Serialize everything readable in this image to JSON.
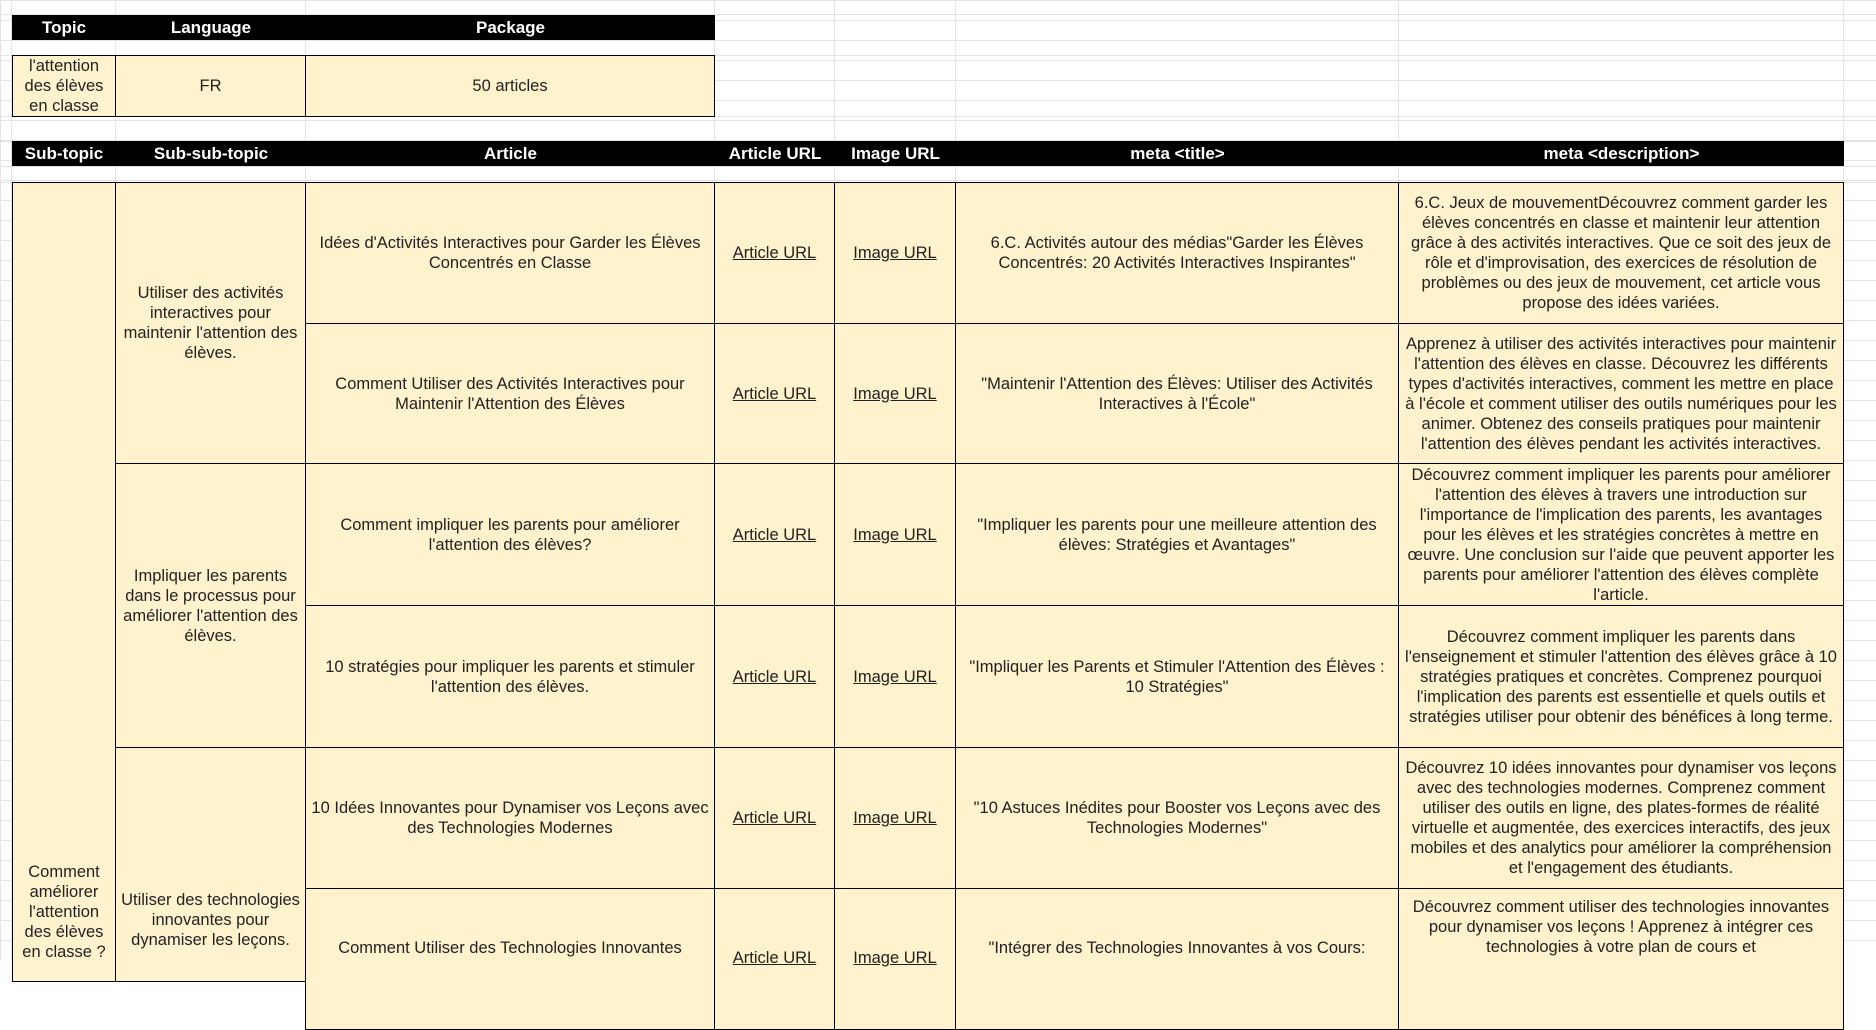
{
  "top_headers": {
    "topic": "Topic",
    "language": "Language",
    "package": "Package"
  },
  "summary": {
    "topic": "l'attention des élèves en classe",
    "language": "FR",
    "package": "50 articles"
  },
  "main_headers": {
    "subtopic": "Sub-topic",
    "subsubtopic": "Sub-sub-topic",
    "article": "Article",
    "article_url": "Article URL",
    "image_url": "Image URL",
    "meta_title": "meta <title>",
    "meta_description": "meta <description>"
  },
  "subtopic": "Comment améliorer l'attention des élèves en classe ?",
  "subsubtopics": [
    "Utiliser des activités interactives pour maintenir l'attention des élèves.",
    "Impliquer les parents dans le processus pour améliorer l'attention des élèves.",
    "Utiliser des technologies innovantes pour dynamiser les leçons."
  ],
  "rows": [
    {
      "article": "Idées d'Activités Interactives pour Garder les Élèves Concentrés en Classe",
      "article_url": "Article URL",
      "image_url": "Image URL",
      "meta_title": "6.C. Activités autour des médias\"Garder les Élèves Concentrés: 20 Activités Interactives Inspirantes\"",
      "meta_description": "6.C. Jeux de mouvementDécouvrez comment garder les élèves concentrés en classe et maintenir leur attention grâce à des activités interactives. Que ce soit des jeux de rôle et d'improvisation, des exercices de résolution de problèmes ou des jeux de mouvement, cet article vous propose des idées variées."
    },
    {
      "article": "Comment Utiliser des Activités Interactives pour Maintenir l'Attention des Élèves",
      "article_url": "Article URL",
      "image_url": "Image URL",
      "meta_title": "\"Maintenir l'Attention des Élèves: Utiliser des Activités Interactives à l'École\"",
      "meta_description": "Apprenez à utiliser des activités interactives pour maintenir l'attention des élèves en classe. Découvrez les différents types d'activités interactives, comment les mettre en place à l'école et comment utiliser des outils numériques pour les animer. Obtenez des conseils pratiques pour maintenir l'attention des élèves pendant les activités interactives."
    },
    {
      "article": "Comment impliquer les parents pour améliorer l'attention des élèves?",
      "article_url": "Article URL",
      "image_url": "Image URL",
      "meta_title": "\"Impliquer les parents pour une meilleure attention des élèves: Stratégies et Avantages\"",
      "meta_description": "Découvrez comment impliquer les parents pour améliorer l'attention des élèves à travers une introduction sur l'importance de l'implication des parents, les avantages pour les élèves et les stratégies concrètes à mettre en œuvre. Une conclusion sur l'aide que peuvent apporter les parents pour améliorer l'attention des élèves complète l'article."
    },
    {
      "article": "10 stratégies pour impliquer les parents et stimuler l'attention des élèves.",
      "article_url": "Article URL",
      "image_url": "Image URL",
      "meta_title": "\"Impliquer les Parents et Stimuler l'Attention des Élèves : 10 Stratégies\"",
      "meta_description": "Découvrez comment impliquer les parents dans l'enseignement et stimuler l'attention des élèves grâce à 10 stratégies pratiques et concrètes. Comprenez pourquoi l'implication des parents est essentielle et quels outils et stratégies utiliser pour obtenir des bénéfices à long terme."
    },
    {
      "article": "10 Idées Innovantes pour Dynamiser vos Leçons avec des Technologies Modernes",
      "article_url": "Article URL",
      "image_url": "Image URL",
      "meta_title": "\"10 Astuces Inédites pour Booster vos Leçons avec des Technologies Modernes\"",
      "meta_description": "Découvrez 10 idées innovantes pour dynamiser vos leçons avec des technologies modernes. Comprenez comment utiliser des outils en ligne, des plates-formes de réalité virtuelle et augmentée, des exercices interactifs, des jeux mobiles et des analytics pour améliorer la compréhension et l'engagement des étudiants."
    },
    {
      "article": "Comment Utiliser des Technologies Innovantes",
      "article_url": "Article URL",
      "image_url": "Image URL",
      "meta_title": "\"Intégrer des Technologies Innovantes à vos Cours:",
      "meta_description": "Découvrez comment utiliser des technologies innovantes pour dynamiser vos leçons ! Apprenez à intégrer ces technologies à votre plan de cours et"
    }
  ]
}
